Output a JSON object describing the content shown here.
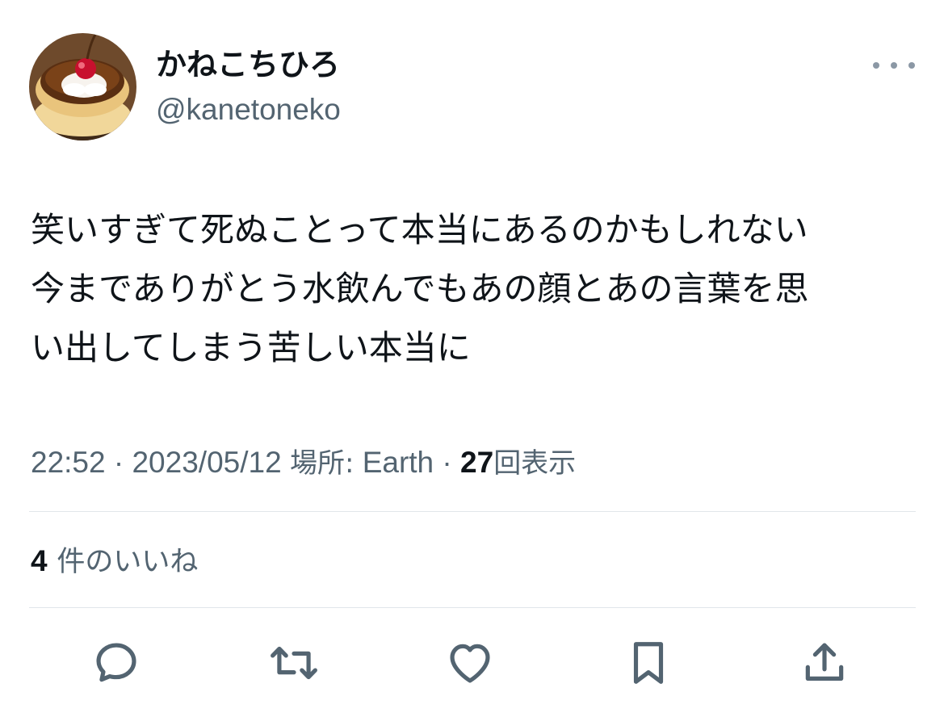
{
  "author": {
    "display_name": "かねこちひろ",
    "handle": "@kanetoneko",
    "avatar_icon": "pudding-avatar-icon"
  },
  "tweet": {
    "lines": [
      "笑いすぎて死ぬことって本当にあるのかもしれない",
      "今までありがとう水飲んでもあの顔とあの言葉を思",
      "い出してしまう苦しい本当に"
    ]
  },
  "meta": {
    "time": "22:52",
    "separator": "·",
    "date": "2023/05/12",
    "location_label": "場所:",
    "location": "Earth",
    "views_count": "27",
    "views_label": "回表示"
  },
  "likes": {
    "count": "4",
    "label": "件のいいね"
  },
  "actions": {
    "reply_icon": "reply-icon",
    "retweet_icon": "retweet-icon",
    "like_icon": "heart-icon",
    "bookmark_icon": "bookmark-icon",
    "share_icon": "share-icon"
  },
  "colors": {
    "text": "#0f1419",
    "secondary": "#536471",
    "icon": "#536471",
    "divider": "#e1e6ea"
  }
}
